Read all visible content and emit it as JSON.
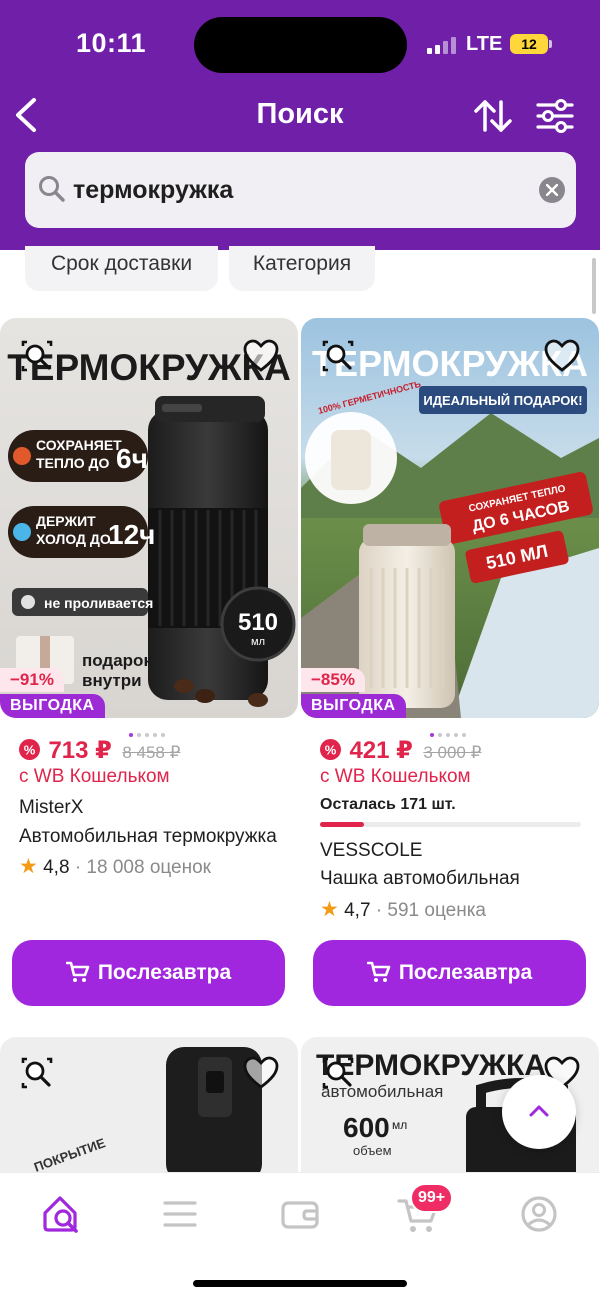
{
  "status_bar": {
    "time": "10:11",
    "network": "LTE",
    "battery": "12"
  },
  "header": {
    "title": "Поиск"
  },
  "search": {
    "value": "термокружка",
    "placeholder": ""
  },
  "chips": [
    {
      "label": "Срок доставки"
    },
    {
      "label": "Категория"
    }
  ],
  "products": [
    {
      "img_title": "ТЕРМОКРУЖКА",
      "img_line1": "СОХРАНЯЕТ ТЕПЛО ДО",
      "img_val1": "6ч",
      "img_line2": "ДЕРЖИТ ХОЛОД ДО",
      "img_val2": "12ч",
      "img_line3": "не проливается",
      "img_volume": "510",
      "img_volume_unit": "мл",
      "img_gift": "подарок внутри",
      "discount": "−91%",
      "promo": "ВЫГОДКА",
      "price": "713 ₽",
      "old_price": "8 458 ₽",
      "wallet": "с WB Кошельком",
      "brand": "MisterX",
      "name": "Автомобильная термокружка",
      "rating": "4,8",
      "reviews": "18 008 оценок",
      "button": "Послезавтра"
    },
    {
      "img_title": "ТЕРМОКРУЖКА",
      "img_banner": "ИДЕАЛЬНЫЙ ПОДАРОК!",
      "img_sealed": "100% ГЕРМЕТИЧНОСТЬ",
      "img_keeps": "СОХРАНЯЕТ ТЕПЛО",
      "img_hours": "ДО 6 ЧАСОВ",
      "img_volume": "510 МЛ",
      "discount": "−85%",
      "promo": "ВЫГОДКА",
      "price": "421 ₽",
      "old_price": "3 000 ₽",
      "wallet": "с WB Кошельком",
      "stock": "Осталась 171 шт.",
      "stock_fill": 0.17,
      "brand": "VESSCOLE",
      "name": "Чашка автомобильная",
      "rating": "4,7",
      "reviews": "591 оценка",
      "button": "Послезавтра"
    }
  ],
  "next_row": [
    {
      "img_text": "ПОКРЫТИЕ"
    },
    {
      "img_title": "ТЕРМОКРУЖКА",
      "img_sub": "автомобильная",
      "img_volume": "600",
      "img_volume_unit": "мл",
      "img_volume_label": "объем"
    }
  ],
  "bottom_nav": {
    "cart_badge": "99+"
  },
  "colors": {
    "header": "#6f1fa8",
    "accent": "#a027dd",
    "price": "#e0244b",
    "star": "#f29b16"
  }
}
